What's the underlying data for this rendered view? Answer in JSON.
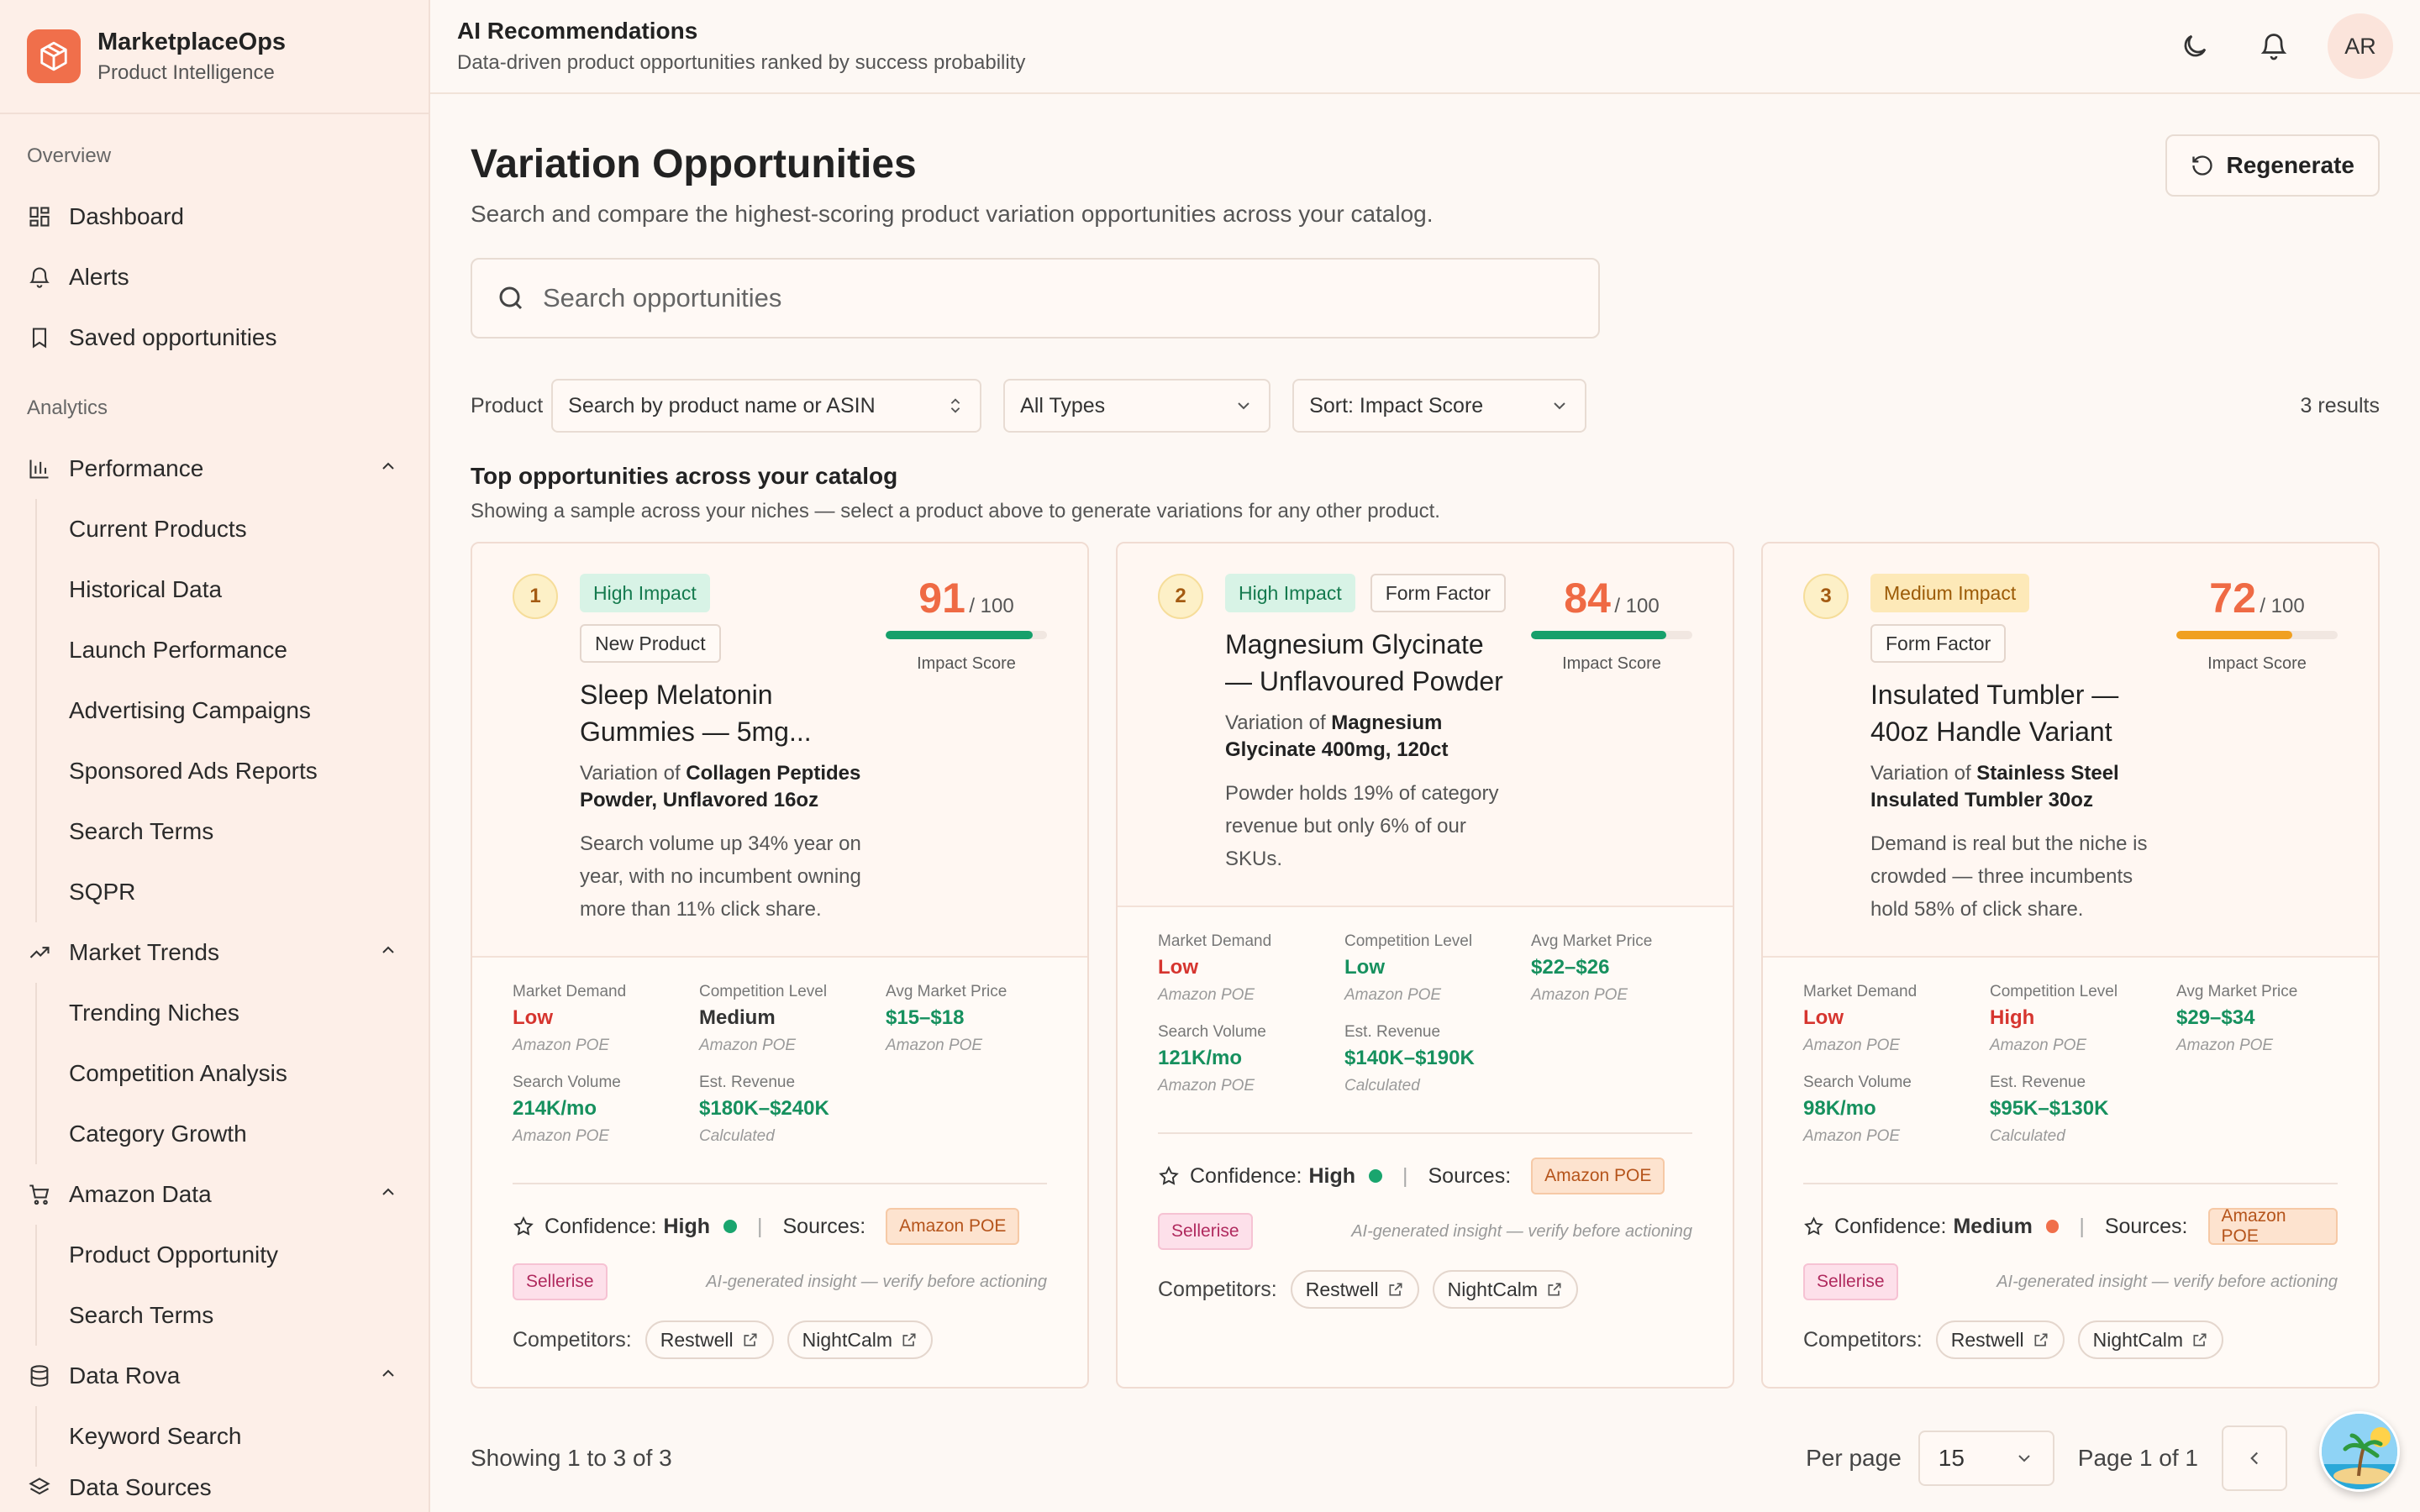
{
  "brand": {
    "title": "MarketplaceOps",
    "subtitle": "Product Intelligence",
    "accent": "#f06f4b"
  },
  "sidebar": {
    "overview_label": "Overview",
    "overview": [
      {
        "label": "Dashboard",
        "icon": "grid-icon"
      },
      {
        "label": "Alerts",
        "icon": "bell-icon"
      },
      {
        "label": "Saved opportunities",
        "icon": "bookmark-icon"
      }
    ],
    "analytics_label": "Analytics",
    "groups": [
      {
        "label": "Performance",
        "icon": "bar-chart-icon",
        "expanded": true,
        "items": [
          "Current Products",
          "Historical Data",
          "Launch Performance",
          "Advertising Campaigns",
          "Sponsored Ads Reports",
          "Search Terms",
          "SQPR"
        ]
      },
      {
        "label": "Market Trends",
        "icon": "trend-icon",
        "expanded": true,
        "items": [
          "Trending Niches",
          "Competition Analysis",
          "Category Growth"
        ]
      },
      {
        "label": "Amazon Data",
        "icon": "cart-icon",
        "expanded": true,
        "items": [
          "Product Opportunity",
          "Search Terms"
        ]
      },
      {
        "label": "Data Rova",
        "icon": "database-icon",
        "expanded": true,
        "items": [
          "Keyword Search"
        ]
      },
      {
        "label": "Data Sources",
        "icon": "layers-icon",
        "expanded": false,
        "items": []
      }
    ]
  },
  "header": {
    "title": "AI Recommendations",
    "subtitle": "Data-driven product opportunities ranked by success probability",
    "avatar": "AR"
  },
  "page": {
    "title": "Variation Opportunities",
    "subtitle": "Search and compare the highest-scoring product variation opportunities across your catalog.",
    "regenerate": "Regenerate",
    "search_placeholder": "Search opportunities"
  },
  "filters": {
    "product_label": "Product",
    "product_placeholder": "Search by product name or ASIN",
    "type": "All Types",
    "sort": "Sort: Impact Score",
    "results": "3 results"
  },
  "section": {
    "title": "Top opportunities across your catalog",
    "subtitle": "Showing a sample across your niches — select a product above to generate variations for any other product."
  },
  "labels": {
    "impact_score": "Impact Score",
    "out_of": "/ 100",
    "variation_of": "Variation of",
    "market_demand": "Market Demand",
    "competition_level": "Competition Level",
    "avg_market_price": "Avg Market Price",
    "search_volume": "Search Volume",
    "est_revenue": "Est. Revenue",
    "confidence": "Confidence:",
    "sources": "Sources:",
    "competitors": "Competitors:",
    "ai_note": "AI-generated insight — verify before actioning",
    "separator": "|"
  },
  "cards": [
    {
      "rank": "1",
      "badges": [
        "High Impact",
        "New Product"
      ],
      "name": "Sleep Melatonin Gummies — 5mg...",
      "parent": "Collagen Peptides Powder, Unflavored 16oz",
      "description": "Search volume up 34% year on year, with no incumbent owning more than 11% click share.",
      "score": "91",
      "score_value": 91,
      "bar_color": "#16a06b",
      "demand": "Low",
      "demand_src": "Amazon POE",
      "competition": "Medium",
      "competition_src": "Amazon POE",
      "price": "$15–$18",
      "price_src": "Amazon POE",
      "volume": "214K/mo",
      "volume_src": "Amazon POE",
      "revenue": "$180K–$240K",
      "revenue_src": "Calculated",
      "confidence": "High",
      "confidence_color": "#1aa56e",
      "source1": "Amazon POE",
      "source2": "Sellerise",
      "competitors": [
        "Restwell",
        "NightCalm"
      ]
    },
    {
      "rank": "2",
      "badges": [
        "High Impact",
        "Form Factor"
      ],
      "name": "Magnesium Glycinate — Unflavoured Powder",
      "parent": "Magnesium Glycinate 400mg, 120ct",
      "description": "Powder holds 19% of category revenue but only 6% of our SKUs.",
      "score": "84",
      "score_value": 84,
      "bar_color": "#16a06b",
      "demand": "Low",
      "demand_src": "Amazon POE",
      "competition": "Low",
      "competition_src": "Amazon POE",
      "price": "$22–$26",
      "price_src": "Amazon POE",
      "volume": "121K/mo",
      "volume_src": "Amazon POE",
      "revenue": "$140K–$190K",
      "revenue_src": "Calculated",
      "confidence": "High",
      "confidence_color": "#1aa56e",
      "source1": "Amazon POE",
      "source2": "Sellerise",
      "competitors": [
        "Restwell",
        "NightCalm"
      ]
    },
    {
      "rank": "3",
      "badges": [
        "Medium Impact",
        "Form Factor"
      ],
      "name": "Insulated Tumbler — 40oz Handle Variant",
      "parent": "Stainless Steel Insulated Tumbler 30oz",
      "description": "Demand is real but the niche is crowded — three incumbents hold 58% of click share.",
      "score": "72",
      "score_value": 72,
      "bar_color": "#f0a020",
      "demand": "Low",
      "demand_src": "Amazon POE",
      "competition": "High",
      "competition_src": "Amazon POE",
      "price": "$29–$34",
      "price_src": "Amazon POE",
      "volume": "98K/mo",
      "volume_src": "Amazon POE",
      "revenue": "$95K–$130K",
      "revenue_src": "Calculated",
      "confidence": "Medium",
      "confidence_color": "#f06f4b",
      "source1": "Amazon POE",
      "source2": "Sellerise",
      "competitors": [
        "Restwell",
        "NightCalm"
      ]
    }
  ],
  "footer": {
    "showing": "Showing 1 to 3 of 3",
    "per_page_label": "Per page",
    "per_page": "15",
    "page_info": "Page 1 of 1"
  }
}
